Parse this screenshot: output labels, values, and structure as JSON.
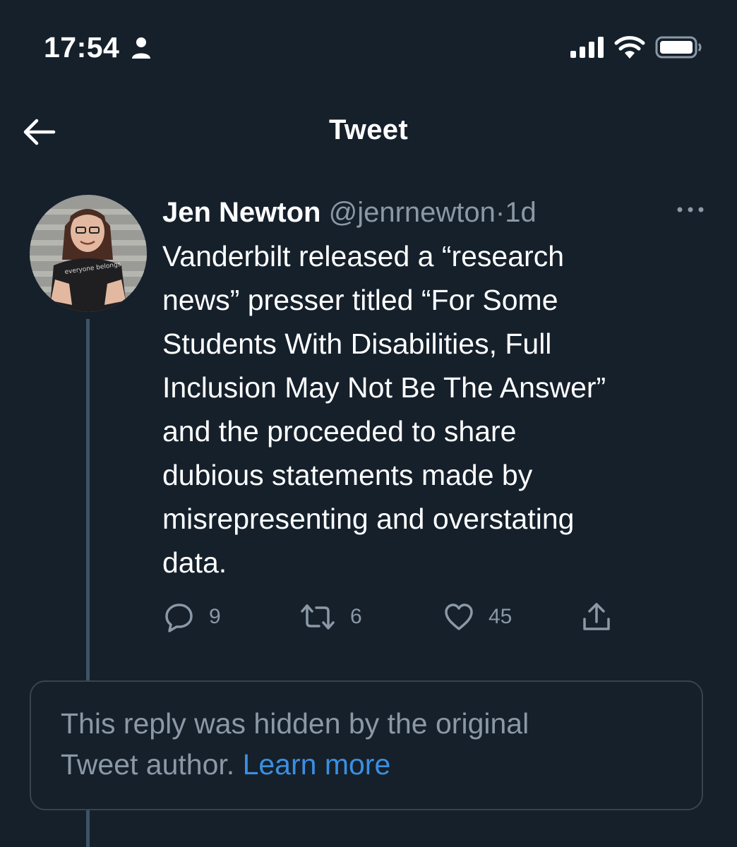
{
  "status_bar": {
    "time": "17:54",
    "person_icon": "person-icon",
    "signal_icon": "cellular-signal-icon",
    "wifi_icon": "wifi-icon",
    "battery_icon": "battery-icon"
  },
  "header": {
    "back_icon": "arrow-left-icon",
    "title": "Tweet"
  },
  "tweet": {
    "author_name": "Jen Newton",
    "author_handle": "@jenrnewton",
    "separator": "·",
    "timestamp": "1d",
    "avatar_shirt_text": "everyone belongs",
    "text_lines": [
      "Vanderbilt released a “research",
      "news” presser titled “For Some",
      "Students With Disabilities, Full",
      "Inclusion May Not Be The Answer”",
      "and the proceeded to share",
      "dubious statements made by",
      "misrepresenting and overstating",
      "data."
    ],
    "actions": {
      "reply_count": "9",
      "retweet_count": "6",
      "like_count": "45"
    }
  },
  "hidden_reply": {
    "line1": "This reply was hidden by the original",
    "line2": "Tweet author.",
    "learn_more": "Learn more"
  },
  "colors": {
    "background": "#15202b",
    "secondary_text": "#8b98a5",
    "link": "#3b8fe0",
    "border": "#38444d"
  }
}
